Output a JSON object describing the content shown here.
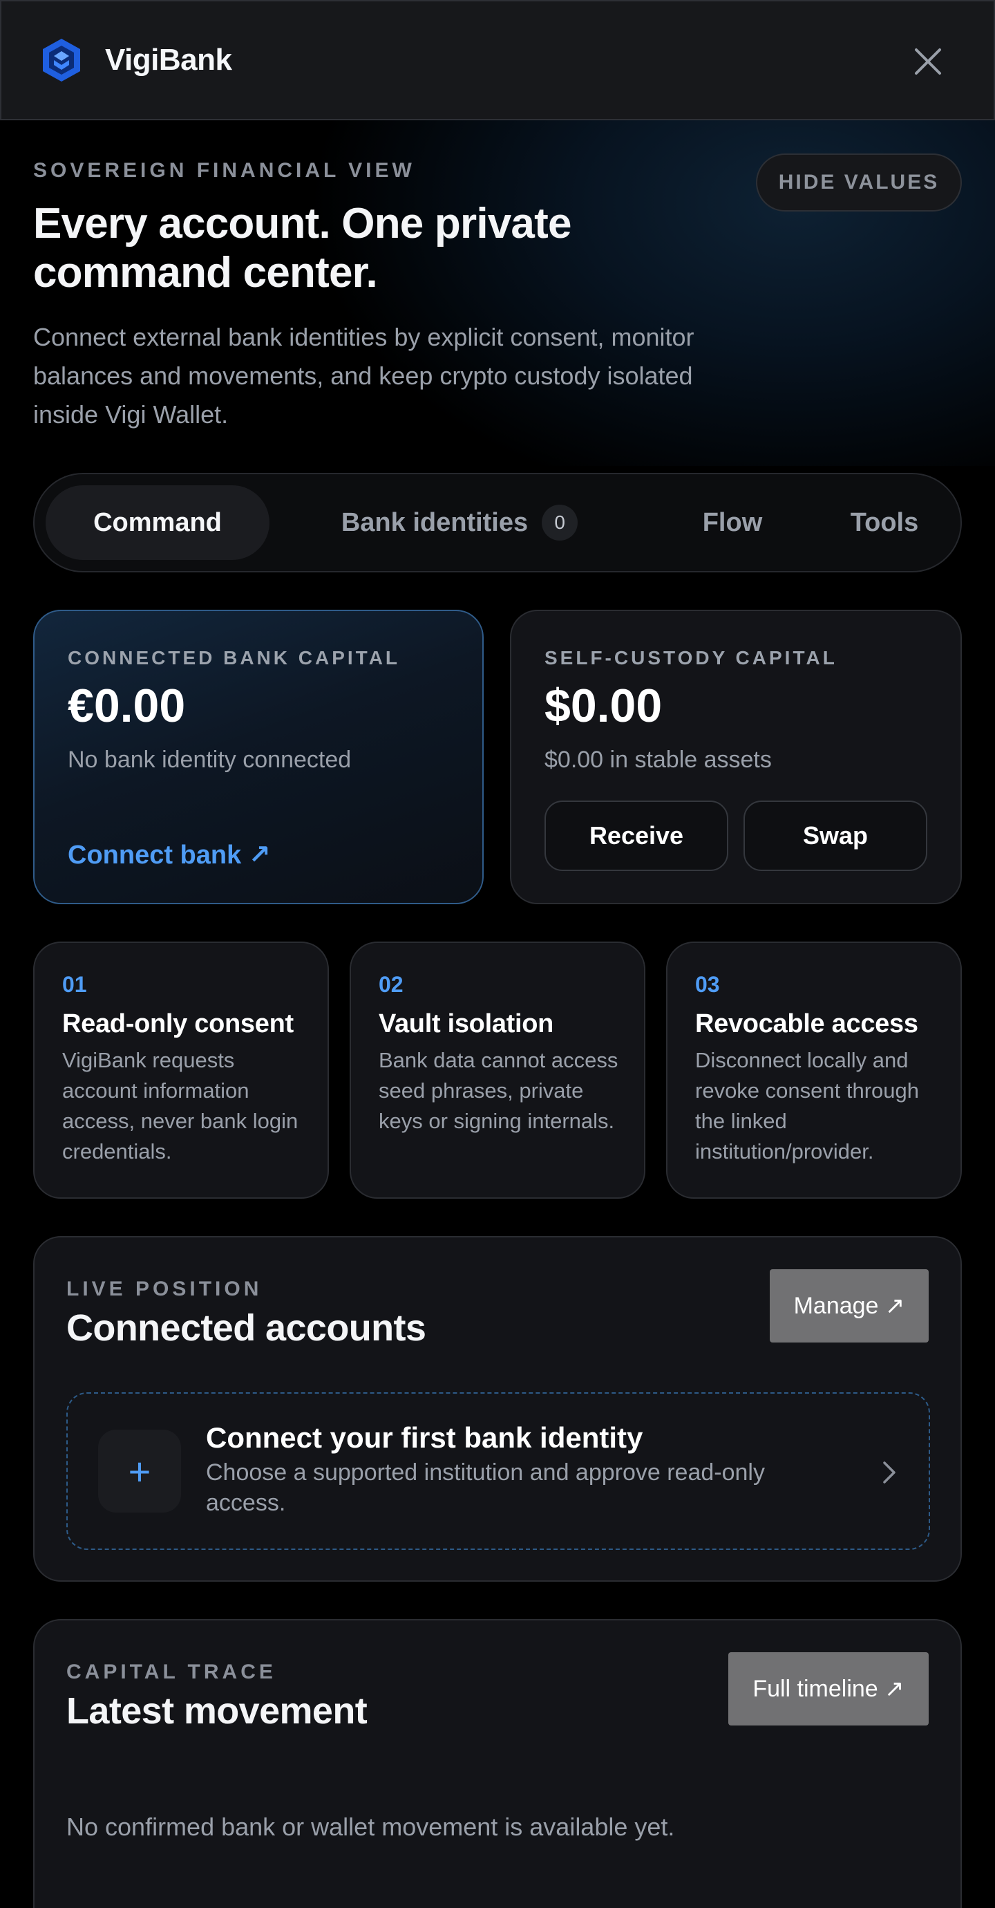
{
  "header": {
    "brand": "VigiBank",
    "logo_icon": "vigibank-logo-icon",
    "close_icon": "close-icon"
  },
  "hero": {
    "eyebrow": "SOVEREIGN FINANCIAL VIEW",
    "hide_values_label": "HIDE VALUES",
    "title": "Every account. One private command center.",
    "description": "Connect external bank identities by explicit consent, monitor balances and movements, and keep crypto custody isolated inside Vigi Wallet."
  },
  "tabs": [
    {
      "label": "Command",
      "active": true
    },
    {
      "label": "Bank identities",
      "badge": "0"
    },
    {
      "label": "Flow"
    },
    {
      "label": "Tools"
    }
  ],
  "bank_capital": {
    "label": "CONNECTED BANK CAPITAL",
    "value": "€0.00",
    "subtitle": "No bank identity connected",
    "link_label": "Connect bank ↗"
  },
  "self_custody": {
    "label": "SELF-CUSTODY CAPITAL",
    "value": "$0.00",
    "subtitle": "$0.00 in stable assets",
    "receive_label": "Receive",
    "swap_label": "Swap"
  },
  "features": [
    {
      "num": "01",
      "title": "Read-only consent",
      "desc": "VigiBank requests account information access, never bank login credentials."
    },
    {
      "num": "02",
      "title": "Vault isolation",
      "desc": "Bank data cannot access seed phrases, private keys or signing internals."
    },
    {
      "num": "03",
      "title": "Revocable access",
      "desc": "Disconnect locally and revoke consent through the linked institution/provider."
    }
  ],
  "live_position": {
    "eyebrow": "LIVE POSITION",
    "title": "Connected accounts",
    "manage_label": "Manage ↗",
    "connect_first": {
      "plus": "+",
      "title": "Connect your first bank identity",
      "desc": "Choose a supported institution and approve read-only access."
    }
  },
  "capital_trace": {
    "eyebrow": "CAPITAL TRACE",
    "title": "Latest movement",
    "timeline_label": "Full timeline ↗",
    "empty_text": "No confirmed bank or wallet movement is available yet."
  },
  "colors": {
    "accent": "#4f9cf5",
    "background": "#000000",
    "card": "#131418"
  }
}
